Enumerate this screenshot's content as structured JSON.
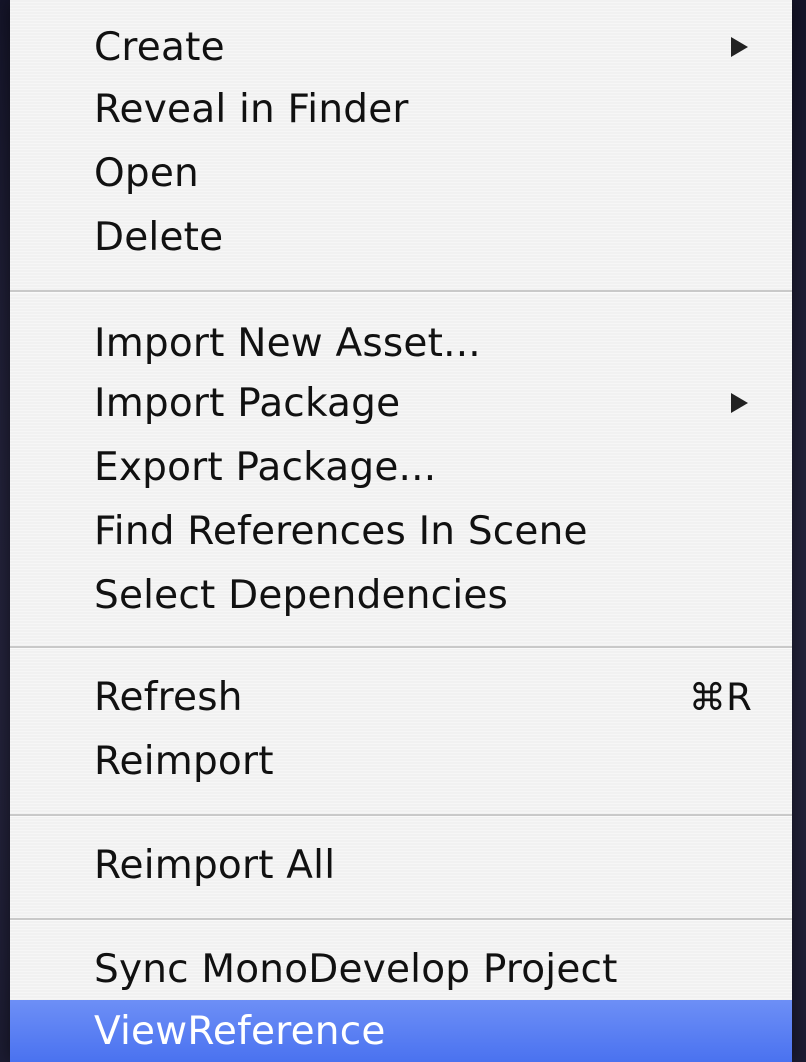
{
  "context_menu": {
    "items": [
      {
        "label": "Create",
        "submenu": true
      },
      {
        "label": "Reveal in Finder"
      },
      {
        "label": "Open"
      },
      {
        "label": "Delete"
      },
      {
        "label": "Import New Asset..."
      },
      {
        "label": "Import Package",
        "submenu": true
      },
      {
        "label": "Export Package..."
      },
      {
        "label": "Find References In Scene"
      },
      {
        "label": "Select Dependencies"
      },
      {
        "label": "Refresh",
        "shortcut": "⌘R"
      },
      {
        "label": "Reimport"
      },
      {
        "label": "Reimport All"
      },
      {
        "label": "Sync MonoDevelop Project"
      },
      {
        "label": "ViewReference",
        "highlighted": true
      }
    ],
    "highlight_color": "#4a72f0"
  }
}
